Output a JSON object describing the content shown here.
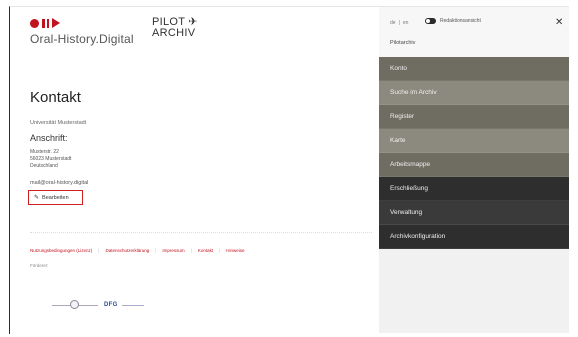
{
  "brand": {
    "name": "Oral-History.Digital",
    "pilot_line1": "PILOT",
    "pilot_line2": "ARCHIV",
    "plane_glyph": "✈"
  },
  "main": {
    "title": "Kontakt",
    "university": "Universität Musterstadt",
    "address_heading": "Anschrift:",
    "address_lines": [
      "Musterstr. 22",
      "56023 Musterstadt",
      "Deutschland"
    ],
    "email": "mail@oral-history.digital",
    "edit_label": "Bearbeiten",
    "edit_icon": "pencil-icon"
  },
  "footer": {
    "links": [
      "Nutzungsbedingungen (Lizenz)",
      "Datenschutzerklärung",
      "Impressum",
      "Kontakt",
      "Hinweise"
    ],
    "sponsors_label": "Förderer:",
    "dfg_label": "DFG"
  },
  "sidebar": {
    "lang": [
      "de",
      "en"
    ],
    "toggle_label": "Redaktionsansicht",
    "close_glyph": "✕",
    "subtitle": "Pilotarchiv",
    "items": [
      {
        "label": "Konto"
      },
      {
        "label": "Suche im Archiv"
      },
      {
        "label": "Register"
      },
      {
        "label": "Karte"
      },
      {
        "label": "Arbeitsmappe"
      },
      {
        "label": "Erschließung"
      },
      {
        "label": "Verwaltung"
      },
      {
        "label": "Archivkonfiguration"
      }
    ]
  },
  "colors": {
    "brand_red": "#c0131f",
    "nav_olive_dark": "#6f6c61",
    "nav_olive_light": "#8c8a7e",
    "nav_dark": "#2e2e2e"
  }
}
